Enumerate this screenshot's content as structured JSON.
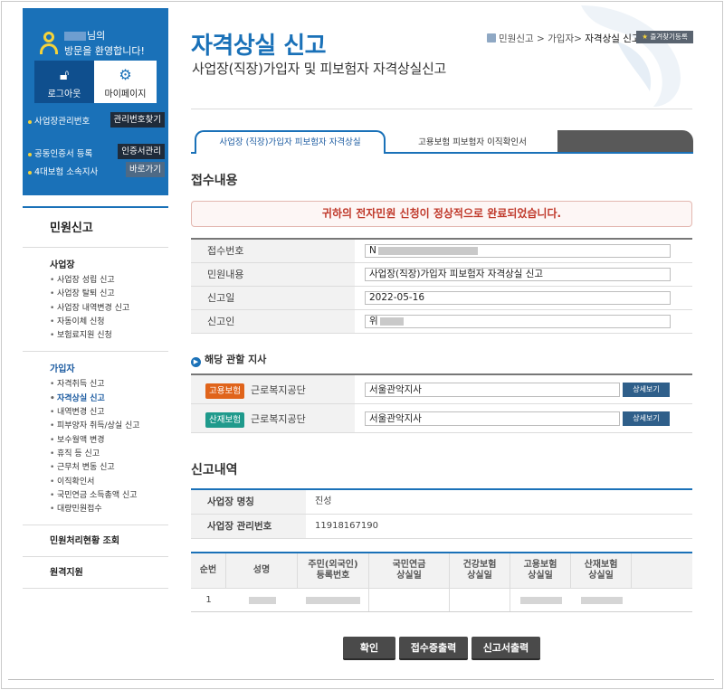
{
  "user": {
    "greeting_line1": "님의",
    "greeting_line2": "방문을 환영합니다!",
    "logout_label": "로그아웃",
    "mypage_label": "마이페이지",
    "rows": [
      {
        "label": "사업장관리번호",
        "button": "관리번호찾기"
      },
      {
        "label": "공동인증서 등록",
        "button": "인증서관리"
      },
      {
        "label": "4대보험 소속지사",
        "button": "바로가기"
      }
    ]
  },
  "nav": {
    "title": "민원신고",
    "groups": [
      {
        "title": "사업장",
        "items": [
          "사업장 성립 신고",
          "사업장 탈퇴 신고",
          "사업장 내역변경 신고",
          "자동이체 신청",
          "보험료지원 신청"
        ]
      },
      {
        "title": "가입자",
        "items": [
          "자격취득 신고",
          "자격상실 신고",
          "내역변경 신고",
          "피부양자 취득/상실 신고",
          "보수월액 변경",
          "휴직 등 신고",
          "근무처 변동 신고",
          "이직확인서",
          "국민연금 소득총액 신고",
          "대량민원접수"
        ],
        "active": "자격상실 신고"
      }
    ],
    "singles": [
      "민원처리현황 조회",
      "원격지원"
    ]
  },
  "header": {
    "title": "자격상실 신고",
    "subtitle": "사업장(직장)가입자 및 피보험자 자격상실신고",
    "breadcrumb": [
      "민원신고",
      "가입자",
      "자격상실 신고"
    ],
    "favorite_label": "즐겨찾기등록"
  },
  "tabs": [
    "사업장 (직장)가입자 피보험자 자격상실",
    "고용보험 피보험자 이직확인서"
  ],
  "receipt": {
    "section_title": "접수내용",
    "notice": "귀하의 전자민원 신청이 정상적으로 완료되었습니다.",
    "fields": [
      {
        "label": "접수번호",
        "value": "N"
      },
      {
        "label": "민원내용",
        "value": "사업장(직장)가입자 피보험자 자격상실 신고"
      },
      {
        "label": "신고일",
        "value": "2022-05-16"
      },
      {
        "label": "신고인",
        "value": "위"
      }
    ]
  },
  "branch": {
    "title": "해당 관할 지사",
    "rows": [
      {
        "tag": "고용보험",
        "org": "근로복지공단",
        "value": "서울관악지사",
        "button": "상세보기"
      },
      {
        "tag": "산재보험",
        "org": "근로복지공단",
        "value": "서울관악지사",
        "button": "상세보기"
      }
    ]
  },
  "history": {
    "section_title": "신고내역",
    "info": [
      {
        "label": "사업장 명칭",
        "value": "진성"
      },
      {
        "label": "사업장 관리번호",
        "value": "11918167190"
      }
    ],
    "columns": [
      "순번",
      "성명",
      "주민(외국인)\n등록번호",
      "국민연금\n상실일",
      "건강보험\n상실일",
      "고용보험\n상실일",
      "산재보험\n상실일"
    ],
    "rows": [
      {
        "no": "1"
      }
    ]
  },
  "actions": {
    "confirm": "확인",
    "receipt_print": "접수증출력",
    "report_print": "신고서출력"
  },
  "colors": {
    "brand": "#1a71b8",
    "notice_text": "#c0392b",
    "tag_employment": "#e0641b",
    "tag_industrial": "#1f9a8c"
  }
}
